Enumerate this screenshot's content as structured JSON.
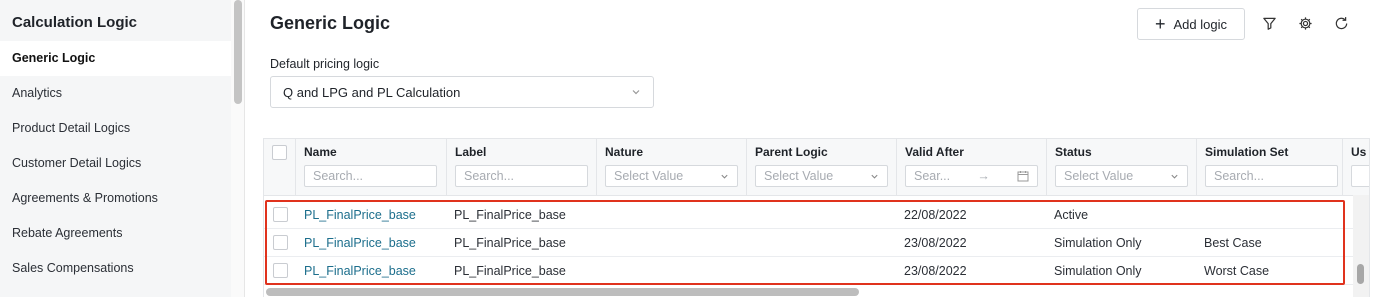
{
  "sidebar": {
    "title": "Calculation Logic",
    "items": [
      {
        "label": "Generic Logic",
        "active": true
      },
      {
        "label": "Analytics"
      },
      {
        "label": "Product Detail Logics"
      },
      {
        "label": "Customer Detail Logics"
      },
      {
        "label": "Agreements & Promotions"
      },
      {
        "label": "Rebate Agreements"
      },
      {
        "label": "Sales Compensations"
      }
    ]
  },
  "header": {
    "title": "Generic Logic",
    "add_label": "Add logic",
    "icons": [
      "filter-icon",
      "gear-icon",
      "refresh-icon"
    ]
  },
  "default_logic": {
    "label": "Default pricing logic",
    "value": "Q and LPG and PL Calculation"
  },
  "grid": {
    "columns": [
      {
        "label": "Name",
        "filter": "Search..."
      },
      {
        "label": "Label",
        "filter": "Search..."
      },
      {
        "label": "Nature",
        "filter": "Select Value"
      },
      {
        "label": "Parent Logic",
        "filter": "Select Value"
      },
      {
        "label": "Valid After",
        "filter": "Sear..."
      },
      {
        "label": "Status",
        "filter": "Select Value"
      },
      {
        "label": "Simulation Set",
        "filter": "Search..."
      },
      {
        "label": "Us",
        "filter": ""
      }
    ],
    "rows": [
      {
        "name": "PL_FinalPrice_base",
        "label": "PL_FinalPrice_base",
        "valid_after": "22/08/2022",
        "status": "Active",
        "simulation_set": ""
      },
      {
        "name": "PL_FinalPrice_base",
        "label": "PL_FinalPrice_base",
        "valid_after": "23/08/2022",
        "status": "Simulation Only",
        "simulation_set": "Best Case"
      },
      {
        "name": "PL_FinalPrice_base",
        "label": "PL_FinalPrice_base",
        "valid_after": "23/08/2022",
        "status": "Simulation Only",
        "simulation_set": "Worst Case"
      }
    ]
  },
  "colors": {
    "link": "#1c6e8c",
    "highlight": "#e0321d"
  }
}
